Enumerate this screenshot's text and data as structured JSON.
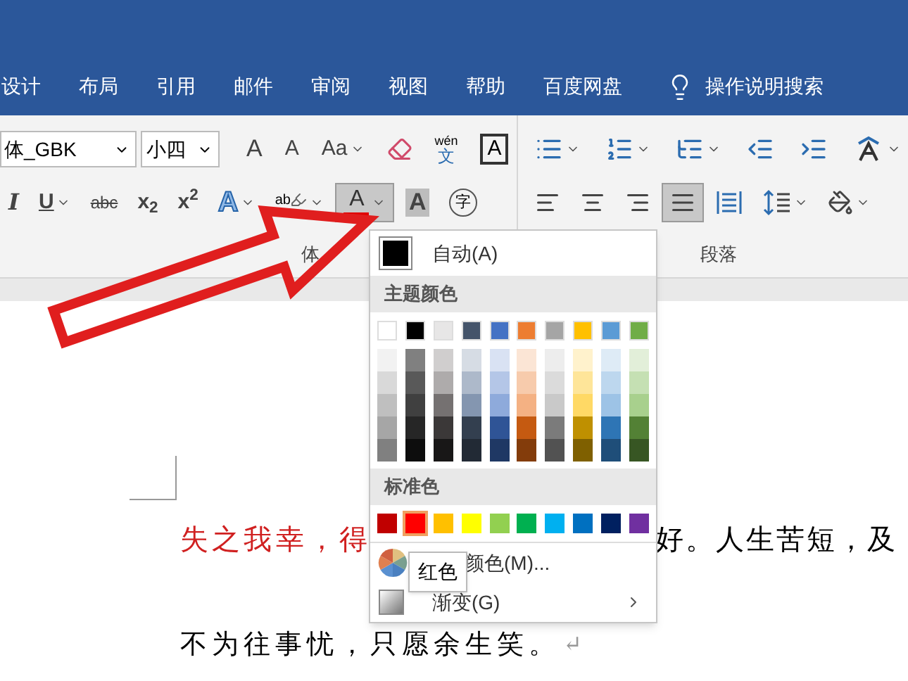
{
  "tabs": [
    {
      "label": "设计"
    },
    {
      "label": "布局"
    },
    {
      "label": "引用"
    },
    {
      "label": "邮件"
    },
    {
      "label": "审阅"
    },
    {
      "label": "视图"
    },
    {
      "label": "帮助"
    },
    {
      "label": "百度网盘"
    }
  ],
  "tell_me": "操作说明搜索",
  "ribbon": {
    "font_name": "体_GBK",
    "font_size": "小四",
    "font_row1": [
      {
        "kind": "grow",
        "text": "A",
        "caret": false,
        "pressed": false
      },
      {
        "kind": "shrink",
        "text": "A",
        "caret": false,
        "pressed": false
      },
      {
        "kind": "case",
        "text": "Aa",
        "caret": true,
        "pressed": false
      },
      {
        "kind": "eraser",
        "caret": false,
        "pressed": false
      },
      {
        "kind": "phonetic",
        "top": "wén",
        "text": "文",
        "caret": false,
        "pressed": false
      },
      {
        "kind": "border",
        "text": "A",
        "caret": false,
        "pressed": false
      }
    ],
    "font_row2": [
      {
        "kind": "italic",
        "text": "I",
        "caret": false,
        "pressed": false
      },
      {
        "kind": "underline",
        "text": "U",
        "caret": true,
        "pressed": false
      },
      {
        "kind": "strike",
        "text": "abc",
        "caret": false,
        "pressed": false
      },
      {
        "kind": "sub",
        "text": "x$_{2}$",
        "caret": false,
        "pressed": false
      },
      {
        "kind": "sup",
        "text": "x$^{2}$",
        "caret": false,
        "pressed": false
      },
      {
        "kind": "effect",
        "text": "A",
        "caret": true,
        "pressed": false
      },
      {
        "kind": "highlight",
        "text": "ab",
        "caret": true,
        "pressed": false
      },
      {
        "kind": "fontcolor",
        "text": "A",
        "caret": true,
        "pressed": true
      },
      {
        "kind": "shading",
        "text": "A",
        "caret": false,
        "pressed": false
      },
      {
        "kind": "enclose",
        "text": "字",
        "caret": false,
        "pressed": false
      }
    ],
    "para_row1": [
      {
        "kind": "bullets",
        "caret": true,
        "pressed": false
      },
      {
        "kind": "numbering",
        "caret": true,
        "pressed": false
      },
      {
        "kind": "multilevel",
        "caret": true,
        "pressed": false
      },
      {
        "kind": "outdent",
        "caret": false,
        "pressed": false
      },
      {
        "kind": "indent",
        "caret": false,
        "pressed": false
      },
      {
        "kind": "direction",
        "caret": true,
        "pressed": false
      }
    ],
    "para_row2": [
      {
        "kind": "left",
        "caret": false,
        "pressed": false
      },
      {
        "kind": "center",
        "caret": false,
        "pressed": false
      },
      {
        "kind": "right",
        "caret": false,
        "pressed": false
      },
      {
        "kind": "justify",
        "caret": false,
        "pressed": true
      },
      {
        "kind": "distribute",
        "caret": false,
        "pressed": false
      },
      {
        "kind": "spacing",
        "caret": true,
        "pressed": false
      },
      {
        "kind": "fill",
        "caret": true,
        "pressed": false
      }
    ],
    "groups": [
      "体",
      "段落"
    ]
  },
  "color_menu": {
    "auto": {
      "label": "自动(A)",
      "color": "#000000"
    },
    "theme_header": "主题颜色",
    "theme_colors": [
      {
        "color": "#ffffff",
        "shades": [
          {
            "color": "#f2f2f2"
          },
          {
            "color": "#d9d9d9"
          },
          {
            "color": "#bfbfbf"
          },
          {
            "color": "#a6a6a6"
          },
          {
            "color": "#808080"
          }
        ]
      },
      {
        "color": "#000000",
        "shades": [
          {
            "color": "#808080"
          },
          {
            "color": "#595959"
          },
          {
            "color": "#404040"
          },
          {
            "color": "#262626"
          },
          {
            "color": "#0d0d0d"
          }
        ]
      },
      {
        "color": "#e7e6e6",
        "shades": [
          {
            "color": "#d0cece"
          },
          {
            "color": "#aeabab"
          },
          {
            "color": "#757171"
          },
          {
            "color": "#3b3838"
          },
          {
            "color": "#181717"
          }
        ]
      },
      {
        "color": "#44546a",
        "shades": [
          {
            "color": "#d6dce4"
          },
          {
            "color": "#adb9ca"
          },
          {
            "color": "#8496b0"
          },
          {
            "color": "#333f4f"
          },
          {
            "color": "#222a35"
          }
        ]
      },
      {
        "color": "#4472c4",
        "shades": [
          {
            "color": "#d9e2f3"
          },
          {
            "color": "#b4c6e7"
          },
          {
            "color": "#8eaadb"
          },
          {
            "color": "#2f5496"
          },
          {
            "color": "#1f3864"
          }
        ]
      },
      {
        "color": "#ed7d31",
        "shades": [
          {
            "color": "#fbe5d5"
          },
          {
            "color": "#f7cbac"
          },
          {
            "color": "#f4b183"
          },
          {
            "color": "#c55a11"
          },
          {
            "color": "#833c0b"
          }
        ]
      },
      {
        "color": "#a5a5a5",
        "shades": [
          {
            "color": "#ededed"
          },
          {
            "color": "#dbdbdb"
          },
          {
            "color": "#c9c9c9"
          },
          {
            "color": "#7b7b7b"
          },
          {
            "color": "#525252"
          }
        ]
      },
      {
        "color": "#ffc000",
        "shades": [
          {
            "color": "#fff2cc"
          },
          {
            "color": "#fee599"
          },
          {
            "color": "#ffd965"
          },
          {
            "color": "#bf9000"
          },
          {
            "color": "#7f6000"
          }
        ]
      },
      {
        "color": "#5b9bd5",
        "shades": [
          {
            "color": "#deebf6"
          },
          {
            "color": "#bdd7ee"
          },
          {
            "color": "#9dc3e6"
          },
          {
            "color": "#2e75b5"
          },
          {
            "color": "#1f4e79"
          }
        ]
      },
      {
        "color": "#70ad47",
        "shades": [
          {
            "color": "#e2efd9"
          },
          {
            "color": "#c5e0b3"
          },
          {
            "color": "#a8d08d"
          },
          {
            "color": "#538135"
          },
          {
            "color": "#375623"
          }
        ]
      }
    ],
    "standard_header": "标准色",
    "standard_colors": [
      {
        "color": "#c00000",
        "selected": false
      },
      {
        "color": "#ff0000",
        "selected": true
      },
      {
        "color": "#ffc000",
        "selected": false
      },
      {
        "color": "#ffff00",
        "selected": false
      },
      {
        "color": "#92d050",
        "selected": false
      },
      {
        "color": "#00b050",
        "selected": false
      },
      {
        "color": "#00b0f0",
        "selected": false
      },
      {
        "color": "#0070c0",
        "selected": false
      },
      {
        "color": "#002060",
        "selected": false
      },
      {
        "color": "#7030a0",
        "selected": false
      }
    ],
    "more_colors": "颜色(M)...",
    "gradient": "渐变(G)",
    "tooltip": "红色"
  },
  "document": {
    "line_1": [
      {
        "text": "失之我幸，得",
        "color": "#d02020"
      },
      {
        "text": "好。人生苦短，及",
        "color": "#000000"
      }
    ],
    "line_2": "不为往事忧，只愿余生笑。",
    "return_mark": "↵"
  }
}
